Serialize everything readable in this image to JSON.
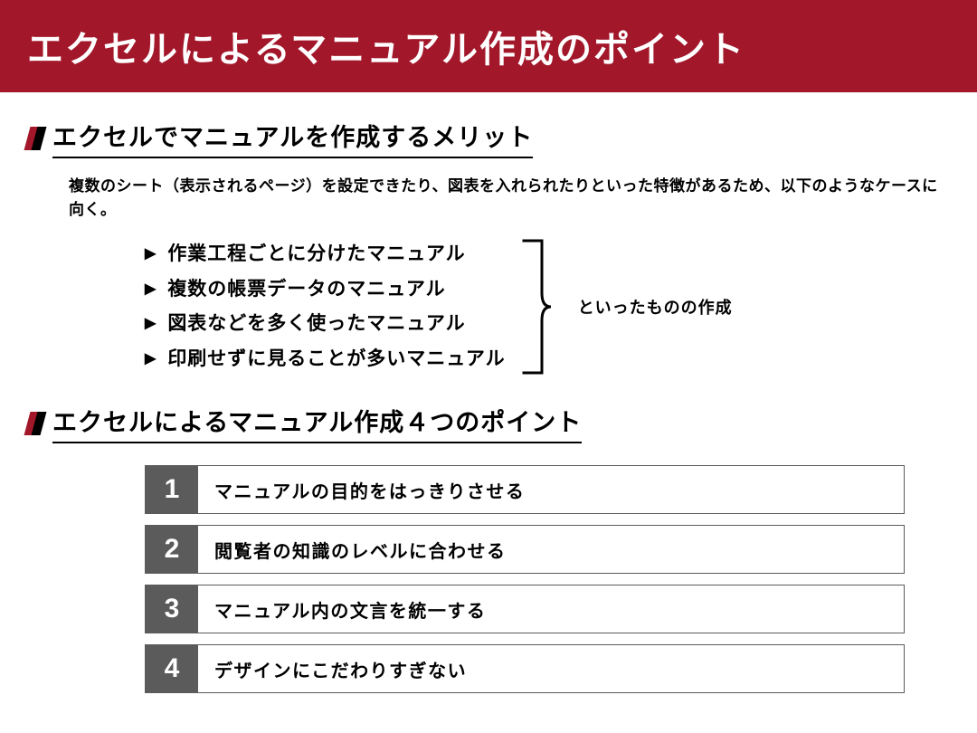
{
  "title": "エクセルによるマニュアル作成のポイント",
  "section1": {
    "heading": "エクセルでマニュアルを作成するメリット",
    "lead": "複数のシート（表示されるページ）を設定できたり、図表を入れられたりといった特徴があるため、以下のようなケースに向く。",
    "bullets": [
      "作業工程ごとに分けたマニュアル",
      "複数の帳票データのマニュアル",
      "図表などを多く使ったマニュアル",
      "印刷せずに見ることが多いマニュアル"
    ],
    "brace_label": "といったものの作成"
  },
  "section2": {
    "heading": "エクセルによるマニュアル作成４つのポイント",
    "points": [
      {
        "num": "1",
        "text": "マニュアルの目的をはっきりさせる"
      },
      {
        "num": "2",
        "text": "閲覧者の知識のレベルに合わせる"
      },
      {
        "num": "3",
        "text": "マニュアル内の文言を統一する"
      },
      {
        "num": "4",
        "text": "デザインにこだわりすぎない"
      }
    ]
  }
}
